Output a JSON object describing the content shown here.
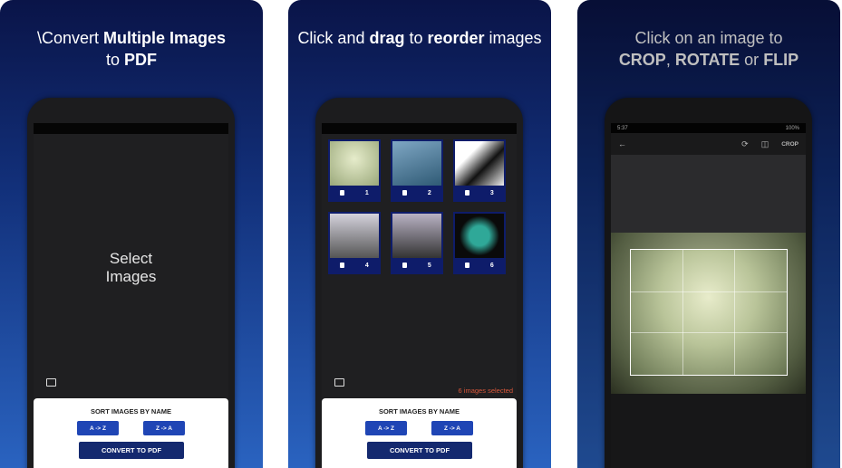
{
  "panels": [
    {
      "headline_prefix": "\\Convert ",
      "headline_bold": "Multiple Images",
      "headline_line2_prefix": "to ",
      "headline_line2_bold": "PDF",
      "empty_state": "Select Images",
      "sort_title": "SORT IMAGES BY NAME",
      "sort_az": "A -> Z",
      "sort_za": "Z -> A",
      "convert": "CONVERT TO PDF"
    },
    {
      "headline_p1": "Click and ",
      "headline_b1": "drag",
      "headline_p2": " to ",
      "headline_b2": "reorder",
      "headline_p3": " images",
      "images": [
        "1",
        "2",
        "3",
        "4",
        "5",
        "6"
      ],
      "selected_text": "6 images selected",
      "sort_title": "SORT IMAGES BY NAME",
      "sort_az": "A -> Z",
      "sort_za": "Z -> A",
      "convert": "CONVERT TO PDF"
    },
    {
      "headline_line1": "Click on an image to",
      "headline_b1": "CROP",
      "headline_p1": ", ",
      "headline_b2": "ROTATE",
      "headline_p2": " or ",
      "headline_b3": "FLIP",
      "status_time": "5:37",
      "status_battery": "100%",
      "crop_label": "CROP"
    }
  ],
  "colors": {
    "accent": "#1f45b5",
    "convert": "#14296f",
    "selected": "#d9573a"
  }
}
